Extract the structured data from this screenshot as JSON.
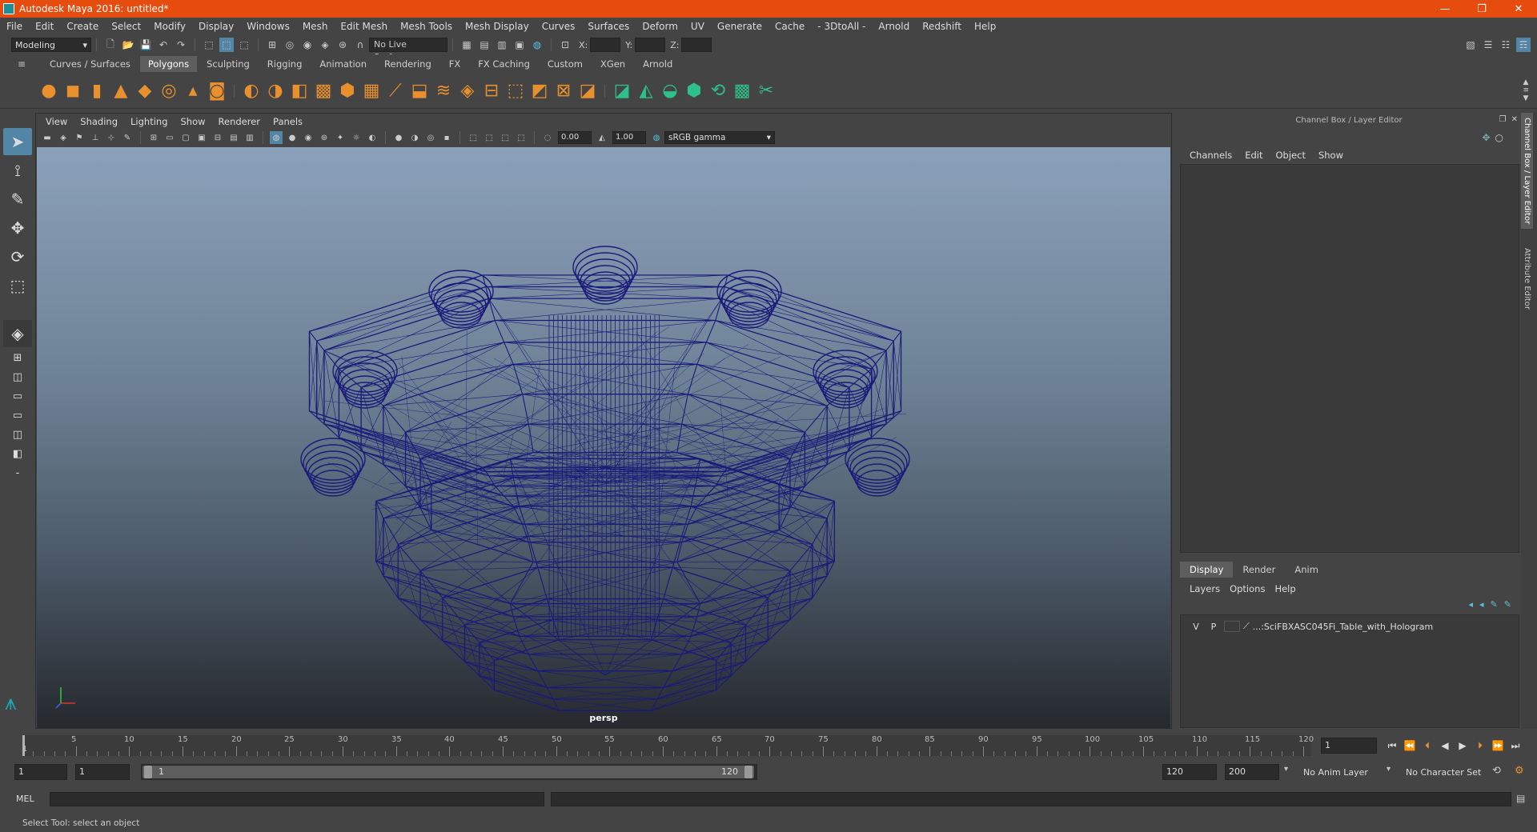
{
  "window": {
    "title": "Autodesk Maya 2016: untitled*",
    "minimize": "—",
    "restore": "❐",
    "close": "✕"
  },
  "menus": [
    "File",
    "Edit",
    "Create",
    "Select",
    "Modify",
    "Display",
    "Windows",
    "Mesh",
    "Edit Mesh",
    "Mesh Tools",
    "Mesh Display",
    "Curves",
    "Surfaces",
    "Deform",
    "UV",
    "Generate",
    "Cache",
    "- 3DtoAll -",
    "Arnold",
    "Redshift",
    "Help"
  ],
  "status": {
    "mode": "Modeling",
    "live_surface": "No Live Surface",
    "x_label": "X:",
    "y_label": "Y:",
    "z_label": "Z:"
  },
  "shelf_tabs": [
    "Curves / Surfaces",
    "Polygons",
    "Sculpting",
    "Rigging",
    "Animation",
    "Rendering",
    "FX",
    "FX Caching",
    "Custom",
    "XGen",
    "Arnold"
  ],
  "shelf_active": "Polygons",
  "viewport": {
    "menus": [
      "View",
      "Shading",
      "Lighting",
      "Show",
      "Renderer",
      "Panels"
    ],
    "exposure": "0.00",
    "gamma": "1.00",
    "color_space": "sRGB gamma",
    "camera_label": "persp",
    "wire_color": "#1a1a7a"
  },
  "channel_box": {
    "title": "Channel Box / Layer Editor",
    "menus": [
      "Channels",
      "Edit",
      "Object",
      "Show"
    ]
  },
  "layer_editor": {
    "tabs": [
      "Display",
      "Render",
      "Anim"
    ],
    "active_tab": "Display",
    "menus": [
      "Layers",
      "Options",
      "Help"
    ],
    "layer": {
      "v": "V",
      "p": "P",
      "name": "...:SciFBXASC045Fi_Table_with_Hologram"
    }
  },
  "side_tabs": [
    "Channel Box / Layer Editor",
    "Attribute Editor"
  ],
  "timeline": {
    "ticks": [
      5,
      10,
      15,
      20,
      25,
      30,
      35,
      40,
      45,
      50,
      55,
      60,
      65,
      70,
      75,
      80,
      85,
      90,
      95,
      100,
      105,
      110,
      115,
      120
    ],
    "start_marker": "1",
    "current_frame": "1"
  },
  "range": {
    "start": "1",
    "playback_start": "1",
    "handle_start": "1",
    "handle_end": "120",
    "playback_end": "120",
    "end": "200",
    "anim_layer": "No Anim Layer",
    "character_set": "No Character Set"
  },
  "command": {
    "label": "MEL"
  },
  "help_line": "Select Tool: select an object"
}
